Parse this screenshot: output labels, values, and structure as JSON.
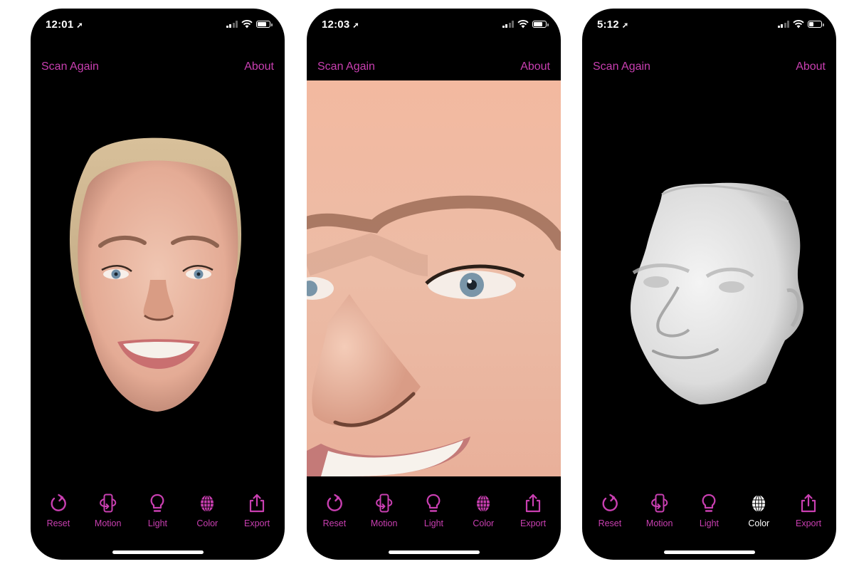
{
  "accent_color": "#c93fb1",
  "phones": [
    {
      "status": {
        "time": "12:01",
        "signal_bars": 2,
        "battery_level": "high"
      },
      "nav": {
        "left": "Scan Again",
        "right": "About"
      },
      "view": "textured-face-front",
      "toolbar": [
        {
          "label": "Reset",
          "icon": "reset-icon",
          "active": false
        },
        {
          "label": "Motion",
          "icon": "motion-icon",
          "active": false
        },
        {
          "label": "Light",
          "icon": "lightbulb-icon",
          "active": false
        },
        {
          "label": "Color",
          "icon": "globe-mesh-icon",
          "active": false
        },
        {
          "label": "Export",
          "icon": "share-icon",
          "active": false
        }
      ]
    },
    {
      "status": {
        "time": "12:03",
        "signal_bars": 2,
        "battery_level": "high"
      },
      "nav": {
        "left": "Scan Again",
        "right": "About"
      },
      "view": "textured-face-closeup",
      "toolbar": [
        {
          "label": "Reset",
          "icon": "reset-icon",
          "active": false
        },
        {
          "label": "Motion",
          "icon": "motion-icon",
          "active": false
        },
        {
          "label": "Light",
          "icon": "lightbulb-icon",
          "active": false
        },
        {
          "label": "Color",
          "icon": "globe-mesh-icon",
          "active": false
        },
        {
          "label": "Export",
          "icon": "share-icon",
          "active": false
        }
      ]
    },
    {
      "status": {
        "time": "5:12",
        "signal_bars": 2,
        "battery_level": "low"
      },
      "nav": {
        "left": "Scan Again",
        "right": "About"
      },
      "view": "untextured-mesh-face",
      "toolbar": [
        {
          "label": "Reset",
          "icon": "reset-icon",
          "active": false
        },
        {
          "label": "Motion",
          "icon": "motion-icon",
          "active": false
        },
        {
          "label": "Light",
          "icon": "lightbulb-icon",
          "active": false
        },
        {
          "label": "Color",
          "icon": "globe-mesh-icon",
          "active": true
        },
        {
          "label": "Export",
          "icon": "share-icon",
          "active": false
        }
      ]
    }
  ]
}
